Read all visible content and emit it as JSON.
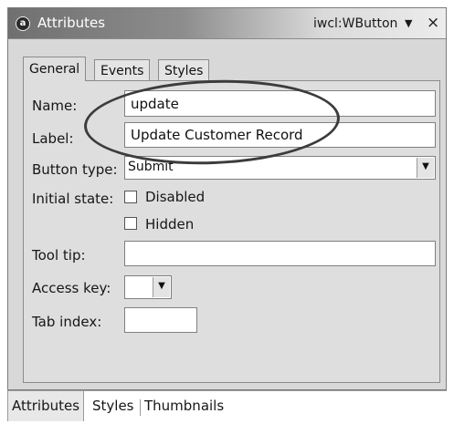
{
  "view": {
    "icon": "attributes-icon",
    "title": "Attributes",
    "target": "iwcl:WButton",
    "menu_glyph": "▼",
    "close_glyph": "×"
  },
  "tabs": [
    {
      "label": "General",
      "active": true
    },
    {
      "label": "Events",
      "active": false
    },
    {
      "label": "Styles",
      "active": false
    }
  ],
  "form": {
    "name": {
      "label": "Name:",
      "value": "update"
    },
    "label": {
      "label": "Label:",
      "value": "Update Customer Record"
    },
    "button_type": {
      "label": "Button type:",
      "value": "Submit"
    },
    "initial_state": {
      "label": "Initial state:",
      "disabled": {
        "label": "Disabled",
        "checked": false
      },
      "hidden": {
        "label": "Hidden",
        "checked": false
      }
    },
    "tool_tip": {
      "label": "Tool tip:",
      "value": ""
    },
    "access_key": {
      "label": "Access key:",
      "value": ""
    },
    "tab_index": {
      "label": "Tab index:",
      "value": ""
    }
  },
  "bottom_tabs": [
    {
      "label": "Attributes",
      "active": true
    },
    {
      "label": "Styles",
      "active": false
    },
    {
      "label": "Thumbnails",
      "active": false
    }
  ],
  "colors": {
    "panel_bg": "#dedede",
    "annotation_stroke": "#3c3c3c"
  }
}
